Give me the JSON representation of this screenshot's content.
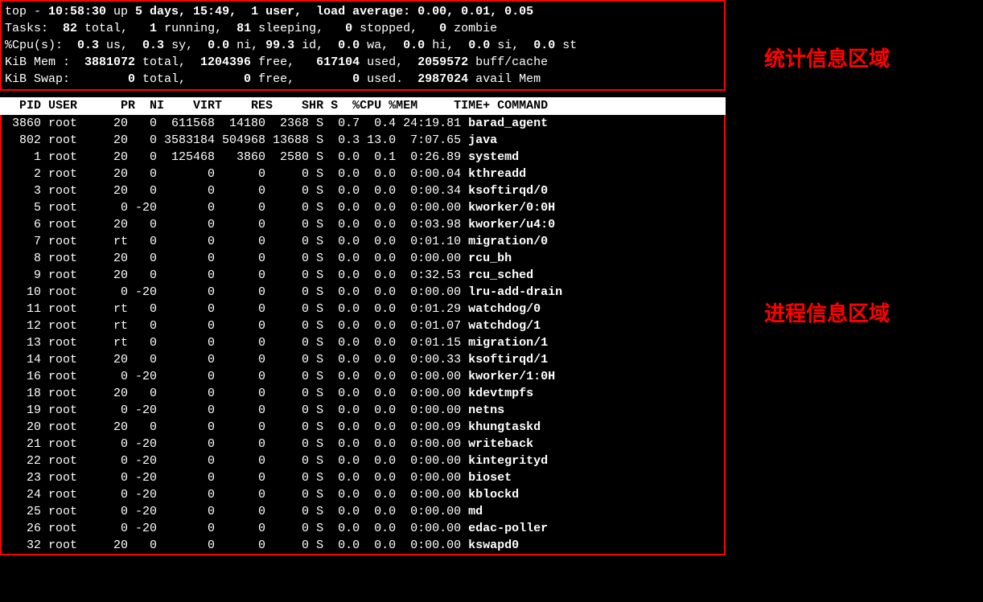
{
  "annotations": {
    "stats_region": "统计信息区域",
    "process_region": "进程信息区域"
  },
  "summary": {
    "line1_prefix": "top - ",
    "time": "10:58:30",
    "up_label": " up ",
    "uptime": "5 days, 15:49,  1 user,  load average: 0.00, 0.01, 0.05",
    "tasks_label": "Tasks:",
    "tasks_total": "  82 ",
    "tasks_total_word": "total,",
    "tasks_running": "   1 ",
    "tasks_running_word": "running,",
    "tasks_sleeping": "  81 ",
    "tasks_sleeping_word": "sleeping,",
    "tasks_stopped": "   0 ",
    "tasks_stopped_word": "stopped,",
    "tasks_zombie": "   0 ",
    "tasks_zombie_word": "zombie",
    "cpu_label": "%Cpu(s):",
    "cpu_us": "  0.3 ",
    "cpu_us_word": "us,",
    "cpu_sy": "  0.3 ",
    "cpu_sy_word": "sy,",
    "cpu_ni": "  0.0 ",
    "cpu_ni_word": "ni,",
    "cpu_id": " 99.3 ",
    "cpu_id_word": "id,",
    "cpu_wa": "  0.0 ",
    "cpu_wa_word": "wa,",
    "cpu_hi": "  0.0 ",
    "cpu_hi_word": "hi,",
    "cpu_si": "  0.0 ",
    "cpu_si_word": "si,",
    "cpu_st": "  0.0 ",
    "cpu_st_word": "st",
    "mem_label": "KiB Mem :",
    "mem_total": "  3881072 ",
    "mem_total_word": "total,",
    "mem_free": "  1204396 ",
    "mem_free_word": "free,",
    "mem_used": "   617104 ",
    "mem_used_word": "used,",
    "mem_buff": "  2059572 ",
    "mem_buff_word": "buff/cache",
    "swap_label": "KiB Swap:",
    "swap_total": "        0 ",
    "swap_total_word": "total,",
    "swap_free": "        0 ",
    "swap_free_word": "free,",
    "swap_used": "        0 ",
    "swap_used_word": "used.",
    "swap_avail": "  2987024 ",
    "swap_avail_word": "avail Mem"
  },
  "header_line": "  PID USER      PR  NI    VIRT    RES    SHR S  %CPU %MEM     TIME+ COMMAND                             ",
  "processes": [
    {
      "pid": " 3860",
      "user": "root",
      "pr": "20",
      "ni": "  0",
      "virt": " 611568",
      "res": " 14180",
      "shr": " 2368",
      "s": "S",
      "cpu": " 0.7",
      "mem": " 0.4",
      "time": "24:19.81",
      "cmd": "barad_agent"
    },
    {
      "pid": "  802",
      "user": "root",
      "pr": "20",
      "ni": "  0",
      "virt": "3583184",
      "res": "504968",
      "shr": "13688",
      "s": "S",
      "cpu": " 0.3",
      "mem": "13.0",
      "time": " 7:07.65",
      "cmd": "java"
    },
    {
      "pid": "    1",
      "user": "root",
      "pr": "20",
      "ni": "  0",
      "virt": " 125468",
      "res": "  3860",
      "shr": " 2580",
      "s": "S",
      "cpu": " 0.0",
      "mem": " 0.1",
      "time": " 0:26.89",
      "cmd": "systemd"
    },
    {
      "pid": "    2",
      "user": "root",
      "pr": "20",
      "ni": "  0",
      "virt": "      0",
      "res": "     0",
      "shr": "    0",
      "s": "S",
      "cpu": " 0.0",
      "mem": " 0.0",
      "time": " 0:00.04",
      "cmd": "kthreadd"
    },
    {
      "pid": "    3",
      "user": "root",
      "pr": "20",
      "ni": "  0",
      "virt": "      0",
      "res": "     0",
      "shr": "    0",
      "s": "S",
      "cpu": " 0.0",
      "mem": " 0.0",
      "time": " 0:00.34",
      "cmd": "ksoftirqd/0"
    },
    {
      "pid": "    5",
      "user": "root",
      "pr": " 0",
      "ni": "-20",
      "virt": "      0",
      "res": "     0",
      "shr": "    0",
      "s": "S",
      "cpu": " 0.0",
      "mem": " 0.0",
      "time": " 0:00.00",
      "cmd": "kworker/0:0H"
    },
    {
      "pid": "    6",
      "user": "root",
      "pr": "20",
      "ni": "  0",
      "virt": "      0",
      "res": "     0",
      "shr": "    0",
      "s": "S",
      "cpu": " 0.0",
      "mem": " 0.0",
      "time": " 0:03.98",
      "cmd": "kworker/u4:0"
    },
    {
      "pid": "    7",
      "user": "root",
      "pr": "rt",
      "ni": "  0",
      "virt": "      0",
      "res": "     0",
      "shr": "    0",
      "s": "S",
      "cpu": " 0.0",
      "mem": " 0.0",
      "time": " 0:01.10",
      "cmd": "migration/0"
    },
    {
      "pid": "    8",
      "user": "root",
      "pr": "20",
      "ni": "  0",
      "virt": "      0",
      "res": "     0",
      "shr": "    0",
      "s": "S",
      "cpu": " 0.0",
      "mem": " 0.0",
      "time": " 0:00.00",
      "cmd": "rcu_bh"
    },
    {
      "pid": "    9",
      "user": "root",
      "pr": "20",
      "ni": "  0",
      "virt": "      0",
      "res": "     0",
      "shr": "    0",
      "s": "S",
      "cpu": " 0.0",
      "mem": " 0.0",
      "time": " 0:32.53",
      "cmd": "rcu_sched"
    },
    {
      "pid": "   10",
      "user": "root",
      "pr": " 0",
      "ni": "-20",
      "virt": "      0",
      "res": "     0",
      "shr": "    0",
      "s": "S",
      "cpu": " 0.0",
      "mem": " 0.0",
      "time": " 0:00.00",
      "cmd": "lru-add-drain"
    },
    {
      "pid": "   11",
      "user": "root",
      "pr": "rt",
      "ni": "  0",
      "virt": "      0",
      "res": "     0",
      "shr": "    0",
      "s": "S",
      "cpu": " 0.0",
      "mem": " 0.0",
      "time": " 0:01.29",
      "cmd": "watchdog/0"
    },
    {
      "pid": "   12",
      "user": "root",
      "pr": "rt",
      "ni": "  0",
      "virt": "      0",
      "res": "     0",
      "shr": "    0",
      "s": "S",
      "cpu": " 0.0",
      "mem": " 0.0",
      "time": " 0:01.07",
      "cmd": "watchdog/1"
    },
    {
      "pid": "   13",
      "user": "root",
      "pr": "rt",
      "ni": "  0",
      "virt": "      0",
      "res": "     0",
      "shr": "    0",
      "s": "S",
      "cpu": " 0.0",
      "mem": " 0.0",
      "time": " 0:01.15",
      "cmd": "migration/1"
    },
    {
      "pid": "   14",
      "user": "root",
      "pr": "20",
      "ni": "  0",
      "virt": "      0",
      "res": "     0",
      "shr": "    0",
      "s": "S",
      "cpu": " 0.0",
      "mem": " 0.0",
      "time": " 0:00.33",
      "cmd": "ksoftirqd/1"
    },
    {
      "pid": "   16",
      "user": "root",
      "pr": " 0",
      "ni": "-20",
      "virt": "      0",
      "res": "     0",
      "shr": "    0",
      "s": "S",
      "cpu": " 0.0",
      "mem": " 0.0",
      "time": " 0:00.00",
      "cmd": "kworker/1:0H"
    },
    {
      "pid": "   18",
      "user": "root",
      "pr": "20",
      "ni": "  0",
      "virt": "      0",
      "res": "     0",
      "shr": "    0",
      "s": "S",
      "cpu": " 0.0",
      "mem": " 0.0",
      "time": " 0:00.00",
      "cmd": "kdevtmpfs"
    },
    {
      "pid": "   19",
      "user": "root",
      "pr": " 0",
      "ni": "-20",
      "virt": "      0",
      "res": "     0",
      "shr": "    0",
      "s": "S",
      "cpu": " 0.0",
      "mem": " 0.0",
      "time": " 0:00.00",
      "cmd": "netns"
    },
    {
      "pid": "   20",
      "user": "root",
      "pr": "20",
      "ni": "  0",
      "virt": "      0",
      "res": "     0",
      "shr": "    0",
      "s": "S",
      "cpu": " 0.0",
      "mem": " 0.0",
      "time": " 0:00.09",
      "cmd": "khungtaskd"
    },
    {
      "pid": "   21",
      "user": "root",
      "pr": " 0",
      "ni": "-20",
      "virt": "      0",
      "res": "     0",
      "shr": "    0",
      "s": "S",
      "cpu": " 0.0",
      "mem": " 0.0",
      "time": " 0:00.00",
      "cmd": "writeback"
    },
    {
      "pid": "   22",
      "user": "root",
      "pr": " 0",
      "ni": "-20",
      "virt": "      0",
      "res": "     0",
      "shr": "    0",
      "s": "S",
      "cpu": " 0.0",
      "mem": " 0.0",
      "time": " 0:00.00",
      "cmd": "kintegrityd"
    },
    {
      "pid": "   23",
      "user": "root",
      "pr": " 0",
      "ni": "-20",
      "virt": "      0",
      "res": "     0",
      "shr": "    0",
      "s": "S",
      "cpu": " 0.0",
      "mem": " 0.0",
      "time": " 0:00.00",
      "cmd": "bioset"
    },
    {
      "pid": "   24",
      "user": "root",
      "pr": " 0",
      "ni": "-20",
      "virt": "      0",
      "res": "     0",
      "shr": "    0",
      "s": "S",
      "cpu": " 0.0",
      "mem": " 0.0",
      "time": " 0:00.00",
      "cmd": "kblockd"
    },
    {
      "pid": "   25",
      "user": "root",
      "pr": " 0",
      "ni": "-20",
      "virt": "      0",
      "res": "     0",
      "shr": "    0",
      "s": "S",
      "cpu": " 0.0",
      "mem": " 0.0",
      "time": " 0:00.00",
      "cmd": "md"
    },
    {
      "pid": "   26",
      "user": "root",
      "pr": " 0",
      "ni": "-20",
      "virt": "      0",
      "res": "     0",
      "shr": "    0",
      "s": "S",
      "cpu": " 0.0",
      "mem": " 0.0",
      "time": " 0:00.00",
      "cmd": "edac-poller"
    },
    {
      "pid": "   32",
      "user": "root",
      "pr": "20",
      "ni": "  0",
      "virt": "      0",
      "res": "     0",
      "shr": "    0",
      "s": "S",
      "cpu": " 0.0",
      "mem": " 0.0",
      "time": " 0:00.00",
      "cmd": "kswapd0"
    }
  ]
}
